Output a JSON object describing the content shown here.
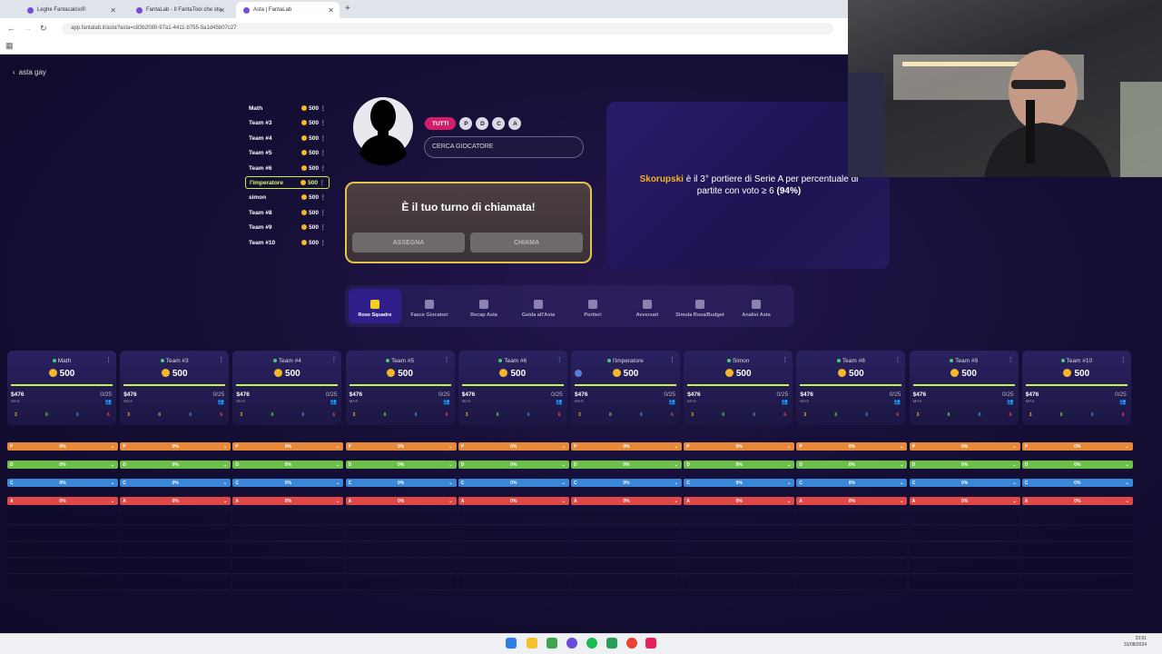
{
  "browser": {
    "tabs": [
      {
        "label": "Leghe Fantacalcio®"
      },
      {
        "label": "FantaLab - Il FantaTool che stu"
      },
      {
        "label": "Asta | FantaLab"
      }
    ],
    "url": "app.fantalab.it/asta?asta=c83b2080-97a1-4411-b755-5a1d45b07c27"
  },
  "back_label": "asta gay",
  "teams": [
    {
      "name": "Math",
      "amount": "500"
    },
    {
      "name": "Team #3",
      "amount": "500"
    },
    {
      "name": "Team #4",
      "amount": "500"
    },
    {
      "name": "Team #5",
      "amount": "500"
    },
    {
      "name": "Team #6",
      "amount": "500"
    },
    {
      "name": "l'imperatore",
      "amount": "500"
    },
    {
      "name": "simon",
      "amount": "500"
    },
    {
      "name": "Team #8",
      "amount": "500"
    },
    {
      "name": "Team #9",
      "amount": "500"
    },
    {
      "name": "Team #10",
      "amount": "500"
    }
  ],
  "filters": [
    "TUTTI",
    "P",
    "D",
    "C",
    "A"
  ],
  "search_placeholder": "CERCA GIOCATORE",
  "turn": {
    "title": "È il tuo turno di chiamata!",
    "assign": "ASSEGNA",
    "call": "CHIAMA"
  },
  "info": {
    "player": "Skorupski",
    "text": " è il 3° portiere di Serie A per percentuale di partite con voto ≥ 6 ",
    "pct": "(94%)"
  },
  "menu_tabs": [
    "Rose Squadre",
    "Fasce Giocatori",
    "Recap Asta",
    "Guida all'Asta",
    "Portieri",
    "Avversari",
    "Simula Rosa/Budget",
    "Analisi Asta"
  ],
  "cards": [
    {
      "name": "Math",
      "budget": "500",
      "max": "$476",
      "max_label": "MAX",
      "slots": "0/25",
      "counts": [
        "3",
        "8",
        "8",
        "6"
      ]
    },
    {
      "name": "Team #3",
      "budget": "500",
      "max": "$476",
      "max_label": "MAX",
      "slots": "0/25",
      "counts": [
        "3",
        "8",
        "8",
        "6"
      ]
    },
    {
      "name": "Team #4",
      "budget": "500",
      "max": "$476",
      "max_label": "MAX",
      "slots": "0/25",
      "counts": [
        "3",
        "8",
        "8",
        "6"
      ]
    },
    {
      "name": "Team #5",
      "budget": "500",
      "max": "$476",
      "max_label": "MAX",
      "slots": "0/25",
      "counts": [
        "3",
        "8",
        "8",
        "6"
      ]
    },
    {
      "name": "Team #6",
      "budget": "500",
      "max": "$476",
      "max_label": "MAX",
      "slots": "0/25",
      "counts": [
        "3",
        "8",
        "8",
        "6"
      ]
    },
    {
      "name": "l'imperatore",
      "budget": "500",
      "max": "$476",
      "max_label": "MAX",
      "slots": "0/25",
      "counts": [
        "3",
        "8",
        "8",
        "6"
      ]
    },
    {
      "name": "Simon",
      "budget": "500",
      "max": "$476",
      "max_label": "MAX",
      "slots": "0/25",
      "counts": [
        "3",
        "8",
        "8",
        "6"
      ]
    },
    {
      "name": "Team #8",
      "budget": "500",
      "max": "$476",
      "max_label": "MAX",
      "slots": "0/25",
      "counts": [
        "3",
        "8",
        "8",
        "6"
      ]
    },
    {
      "name": "Team #9",
      "budget": "500",
      "max": "$476",
      "max_label": "MAX",
      "slots": "0/25",
      "counts": [
        "3",
        "8",
        "8",
        "6"
      ]
    },
    {
      "name": "Team #10",
      "budget": "500",
      "max": "$476",
      "max_label": "MAX",
      "slots": "0/25",
      "counts": [
        "3",
        "8",
        "8",
        "6"
      ]
    }
  ],
  "roles": [
    {
      "letter": "P",
      "pct": "0%",
      "color": "#e8893a"
    },
    {
      "letter": "D",
      "pct": "0%",
      "color": "#6cc04a"
    },
    {
      "letter": "C",
      "pct": "0%",
      "color": "#3a86d8"
    },
    {
      "letter": "A",
      "pct": "0%",
      "color": "#e04848"
    }
  ],
  "count_colors": [
    "#f5b62a",
    "#6cc04a",
    "#3a86d8",
    "#e04848"
  ],
  "clock": {
    "time": "23:51",
    "date": "31/08/2024"
  }
}
